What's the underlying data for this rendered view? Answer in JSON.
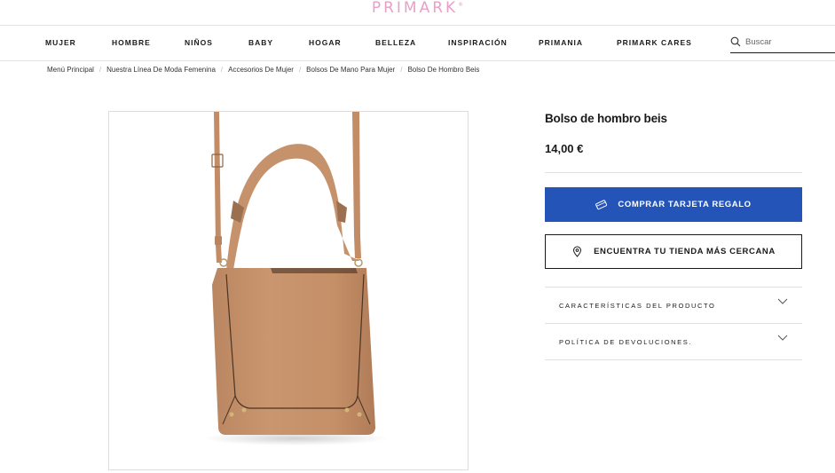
{
  "header": {
    "logo": "PRIMARK",
    "logo_mark": "®"
  },
  "nav": {
    "items": [
      {
        "label": "MUJER"
      },
      {
        "label": "HOMBRE"
      },
      {
        "label": "NIÑOS"
      },
      {
        "label": "BABY"
      },
      {
        "label": "HOGAR"
      },
      {
        "label": "BELLEZA"
      },
      {
        "label": "INSPIRACIÓN"
      },
      {
        "label": "PRIMANIA"
      },
      {
        "label": "PRIMARK CARES"
      }
    ],
    "search": {
      "placeholder": "Buscar",
      "icon": "search-icon"
    }
  },
  "breadcrumb": [
    "Menú Principal",
    "Nuestra Línea De Moda Femenina",
    "Accesorios De Mujer",
    "Bolsos De Mano Para Mujer",
    "Bolso De Hombro Beis"
  ],
  "product": {
    "title": "Bolso de hombro beis",
    "price": "14,00 €",
    "image": "beige-shoulder-bag-photo",
    "buttons": {
      "gift_card": {
        "label": "COMPRAR TARJETA REGALO",
        "icon": "gift-card-icon"
      },
      "store_finder": {
        "label": "ENCUENTRA TU TIENDA MÁS CERCANA",
        "icon": "location-pin-icon"
      }
    },
    "accordions": [
      {
        "label": "CARACTERÍSTICAS DEL PRODUCTO",
        "icon": "chevron-down-icon"
      },
      {
        "label": "POLÍTICA DE DEVOLUCIONES.",
        "icon": "chevron-down-icon"
      }
    ]
  },
  "colors": {
    "logo_pink": "#e8a0c8",
    "primary_blue": "#2454b7",
    "bag_tan": "#c4926a",
    "text": "#1a1a1a"
  }
}
